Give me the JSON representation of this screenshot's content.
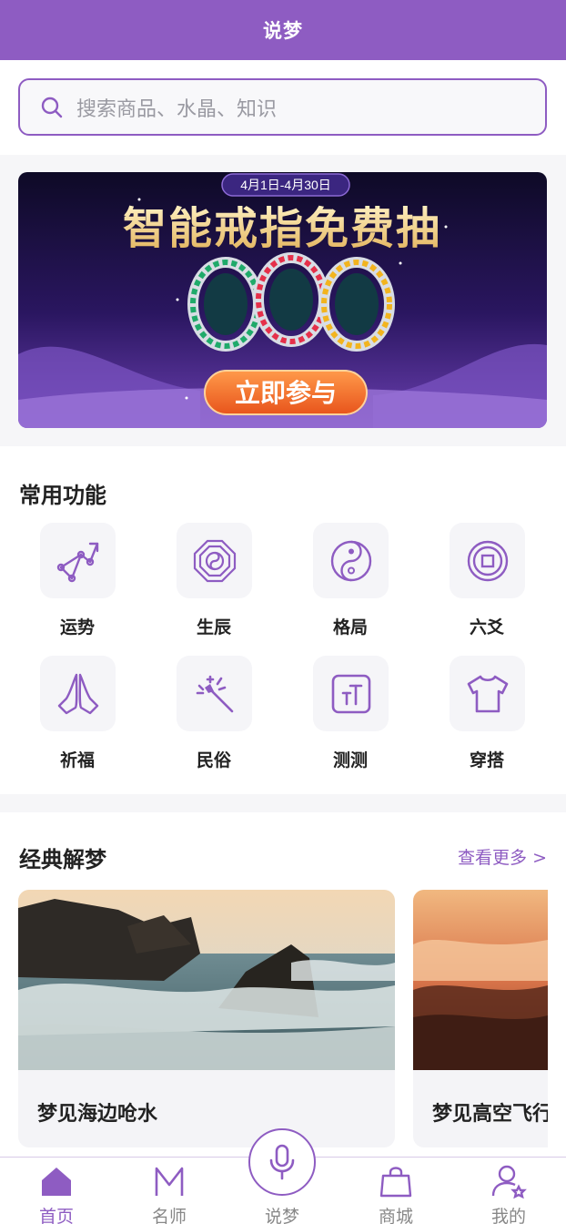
{
  "header": {
    "title": "说梦"
  },
  "search": {
    "placeholder": "搜索商品、水晶、知识"
  },
  "banner": {
    "date_range": "4月1日-4月30日",
    "headline": "智能戒指免费抽",
    "cta": "立即参与"
  },
  "functions": {
    "title": "常用功能",
    "items": [
      {
        "label": "运势",
        "icon": "trend-chart-icon"
      },
      {
        "label": "生辰",
        "icon": "bagua-icon"
      },
      {
        "label": "格局",
        "icon": "yin-yang-icon"
      },
      {
        "label": "六爻",
        "icon": "coin-icon"
      },
      {
        "label": "祈福",
        "icon": "praying-hands-icon"
      },
      {
        "label": "民俗",
        "icon": "magic-wand-icon"
      },
      {
        "label": "测测",
        "icon": "text-size-icon"
      },
      {
        "label": "穿搭",
        "icon": "tshirt-icon"
      }
    ]
  },
  "dreams": {
    "title": "经典解梦",
    "more": "查看更多 >",
    "cards": [
      {
        "title": "梦见海边呛水"
      },
      {
        "title": "梦见高空飞行"
      }
    ]
  },
  "tabbar": {
    "items": [
      {
        "label": "首页",
        "icon": "home-icon",
        "active": true
      },
      {
        "label": "名师",
        "icon": "m-letter-icon",
        "active": false
      },
      {
        "label": "说梦",
        "icon": "microphone-icon",
        "active": false
      },
      {
        "label": "商城",
        "icon": "shopping-bag-icon",
        "active": false
      },
      {
        "label": "我的",
        "icon": "user-icon",
        "active": false
      }
    ]
  },
  "colors": {
    "brand": "#8e5cc2",
    "banner_cta": "#f06a2a",
    "headline_gold": "#f3d38a"
  }
}
